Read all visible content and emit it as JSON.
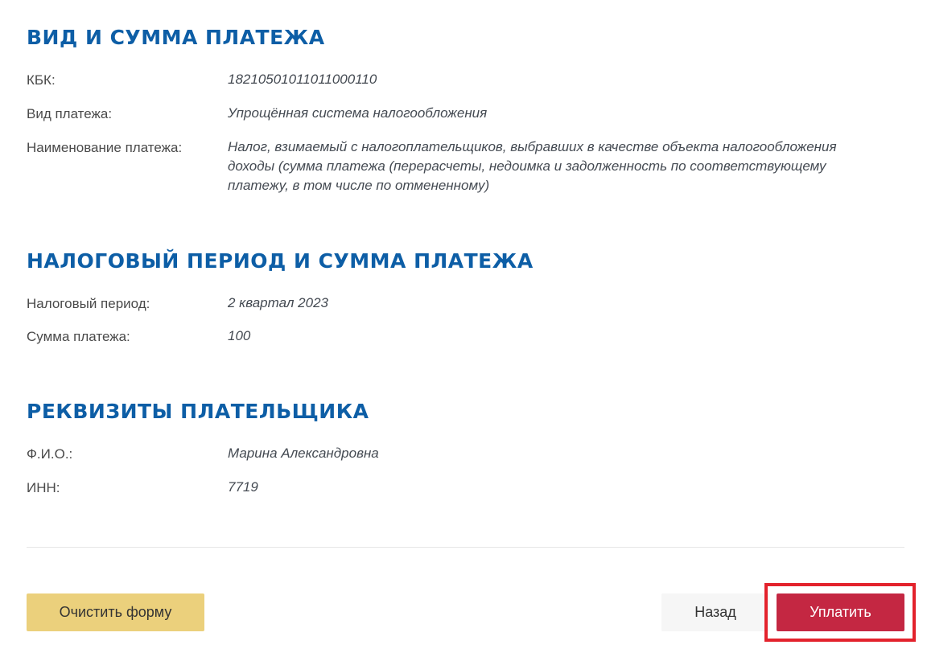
{
  "payment_type_section": {
    "title": "ВИД И СУММА ПЛАТЕЖА",
    "kbk_label": "КБК:",
    "kbk_value": "18210501011011000110",
    "payment_type_label": "Вид платежа:",
    "payment_type_value": "Упрощённая система налогообложения",
    "payment_name_label": "Наименование платежа:",
    "payment_name_value": "Налог, взимаемый с налогоплательщиков, выбравших в качестве объекта налогообложения доходы (сумма платежа (перерасчеты, недоимка и задолженность по соответствующему платежу, в том числе по отмененному)"
  },
  "tax_period_section": {
    "title": "НАЛОГОВЫЙ ПЕРИОД И СУММА ПЛАТЕЖА",
    "period_label": "Налоговый период:",
    "period_value": "2 квартал 2023",
    "amount_label": "Сумма платежа:",
    "amount_value": "100"
  },
  "payer_section": {
    "title": "РЕКВИЗИТЫ ПЛАТЕЛЬЩИКА",
    "fio_label": "Ф.И.О.:",
    "fio_value": "Марина Александровна",
    "inn_label": "ИНН:",
    "inn_value": "7719"
  },
  "actions": {
    "clear_label": "Очистить форму",
    "back_label": "Назад",
    "pay_label": "Уплатить"
  },
  "colors": {
    "heading": "#0d5ea6",
    "clear_button": "#ebd07c",
    "pay_button": "#c42742",
    "highlight_border": "#e3222c"
  }
}
